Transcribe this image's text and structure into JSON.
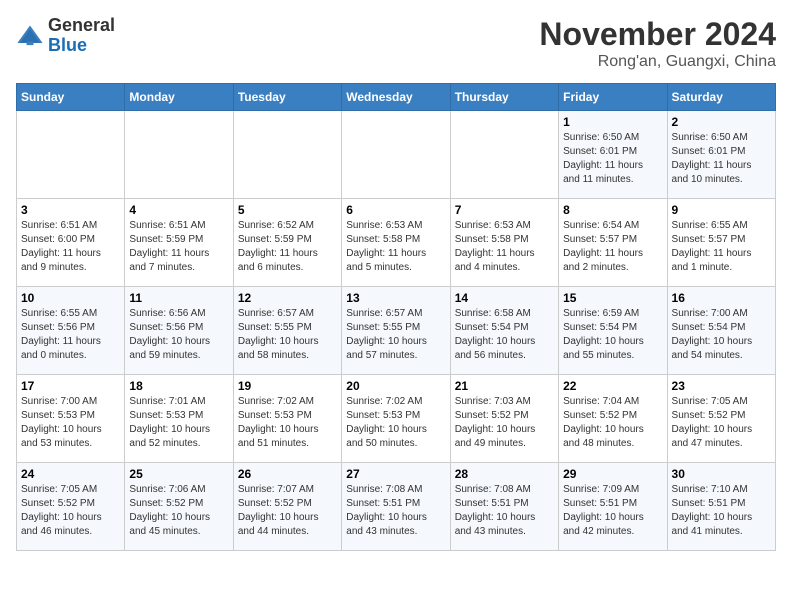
{
  "header": {
    "logo_general": "General",
    "logo_blue": "Blue",
    "month_title": "November 2024",
    "location": "Rong'an, Guangxi, China"
  },
  "days_of_week": [
    "Sunday",
    "Monday",
    "Tuesday",
    "Wednesday",
    "Thursday",
    "Friday",
    "Saturday"
  ],
  "weeks": [
    [
      {
        "day": "",
        "info": ""
      },
      {
        "day": "",
        "info": ""
      },
      {
        "day": "",
        "info": ""
      },
      {
        "day": "",
        "info": ""
      },
      {
        "day": "",
        "info": ""
      },
      {
        "day": "1",
        "info": "Sunrise: 6:50 AM\nSunset: 6:01 PM\nDaylight: 11 hours\nand 11 minutes."
      },
      {
        "day": "2",
        "info": "Sunrise: 6:50 AM\nSunset: 6:01 PM\nDaylight: 11 hours\nand 10 minutes."
      }
    ],
    [
      {
        "day": "3",
        "info": "Sunrise: 6:51 AM\nSunset: 6:00 PM\nDaylight: 11 hours\nand 9 minutes."
      },
      {
        "day": "4",
        "info": "Sunrise: 6:51 AM\nSunset: 5:59 PM\nDaylight: 11 hours\nand 7 minutes."
      },
      {
        "day": "5",
        "info": "Sunrise: 6:52 AM\nSunset: 5:59 PM\nDaylight: 11 hours\nand 6 minutes."
      },
      {
        "day": "6",
        "info": "Sunrise: 6:53 AM\nSunset: 5:58 PM\nDaylight: 11 hours\nand 5 minutes."
      },
      {
        "day": "7",
        "info": "Sunrise: 6:53 AM\nSunset: 5:58 PM\nDaylight: 11 hours\nand 4 minutes."
      },
      {
        "day": "8",
        "info": "Sunrise: 6:54 AM\nSunset: 5:57 PM\nDaylight: 11 hours\nand 2 minutes."
      },
      {
        "day": "9",
        "info": "Sunrise: 6:55 AM\nSunset: 5:57 PM\nDaylight: 11 hours\nand 1 minute."
      }
    ],
    [
      {
        "day": "10",
        "info": "Sunrise: 6:55 AM\nSunset: 5:56 PM\nDaylight: 11 hours\nand 0 minutes."
      },
      {
        "day": "11",
        "info": "Sunrise: 6:56 AM\nSunset: 5:56 PM\nDaylight: 10 hours\nand 59 minutes."
      },
      {
        "day": "12",
        "info": "Sunrise: 6:57 AM\nSunset: 5:55 PM\nDaylight: 10 hours\nand 58 minutes."
      },
      {
        "day": "13",
        "info": "Sunrise: 6:57 AM\nSunset: 5:55 PM\nDaylight: 10 hours\nand 57 minutes."
      },
      {
        "day": "14",
        "info": "Sunrise: 6:58 AM\nSunset: 5:54 PM\nDaylight: 10 hours\nand 56 minutes."
      },
      {
        "day": "15",
        "info": "Sunrise: 6:59 AM\nSunset: 5:54 PM\nDaylight: 10 hours\nand 55 minutes."
      },
      {
        "day": "16",
        "info": "Sunrise: 7:00 AM\nSunset: 5:54 PM\nDaylight: 10 hours\nand 54 minutes."
      }
    ],
    [
      {
        "day": "17",
        "info": "Sunrise: 7:00 AM\nSunset: 5:53 PM\nDaylight: 10 hours\nand 53 minutes."
      },
      {
        "day": "18",
        "info": "Sunrise: 7:01 AM\nSunset: 5:53 PM\nDaylight: 10 hours\nand 52 minutes."
      },
      {
        "day": "19",
        "info": "Sunrise: 7:02 AM\nSunset: 5:53 PM\nDaylight: 10 hours\nand 51 minutes."
      },
      {
        "day": "20",
        "info": "Sunrise: 7:02 AM\nSunset: 5:53 PM\nDaylight: 10 hours\nand 50 minutes."
      },
      {
        "day": "21",
        "info": "Sunrise: 7:03 AM\nSunset: 5:52 PM\nDaylight: 10 hours\nand 49 minutes."
      },
      {
        "day": "22",
        "info": "Sunrise: 7:04 AM\nSunset: 5:52 PM\nDaylight: 10 hours\nand 48 minutes."
      },
      {
        "day": "23",
        "info": "Sunrise: 7:05 AM\nSunset: 5:52 PM\nDaylight: 10 hours\nand 47 minutes."
      }
    ],
    [
      {
        "day": "24",
        "info": "Sunrise: 7:05 AM\nSunset: 5:52 PM\nDaylight: 10 hours\nand 46 minutes."
      },
      {
        "day": "25",
        "info": "Sunrise: 7:06 AM\nSunset: 5:52 PM\nDaylight: 10 hours\nand 45 minutes."
      },
      {
        "day": "26",
        "info": "Sunrise: 7:07 AM\nSunset: 5:52 PM\nDaylight: 10 hours\nand 44 minutes."
      },
      {
        "day": "27",
        "info": "Sunrise: 7:08 AM\nSunset: 5:51 PM\nDaylight: 10 hours\nand 43 minutes."
      },
      {
        "day": "28",
        "info": "Sunrise: 7:08 AM\nSunset: 5:51 PM\nDaylight: 10 hours\nand 43 minutes."
      },
      {
        "day": "29",
        "info": "Sunrise: 7:09 AM\nSunset: 5:51 PM\nDaylight: 10 hours\nand 42 minutes."
      },
      {
        "day": "30",
        "info": "Sunrise: 7:10 AM\nSunset: 5:51 PM\nDaylight: 10 hours\nand 41 minutes."
      }
    ]
  ]
}
